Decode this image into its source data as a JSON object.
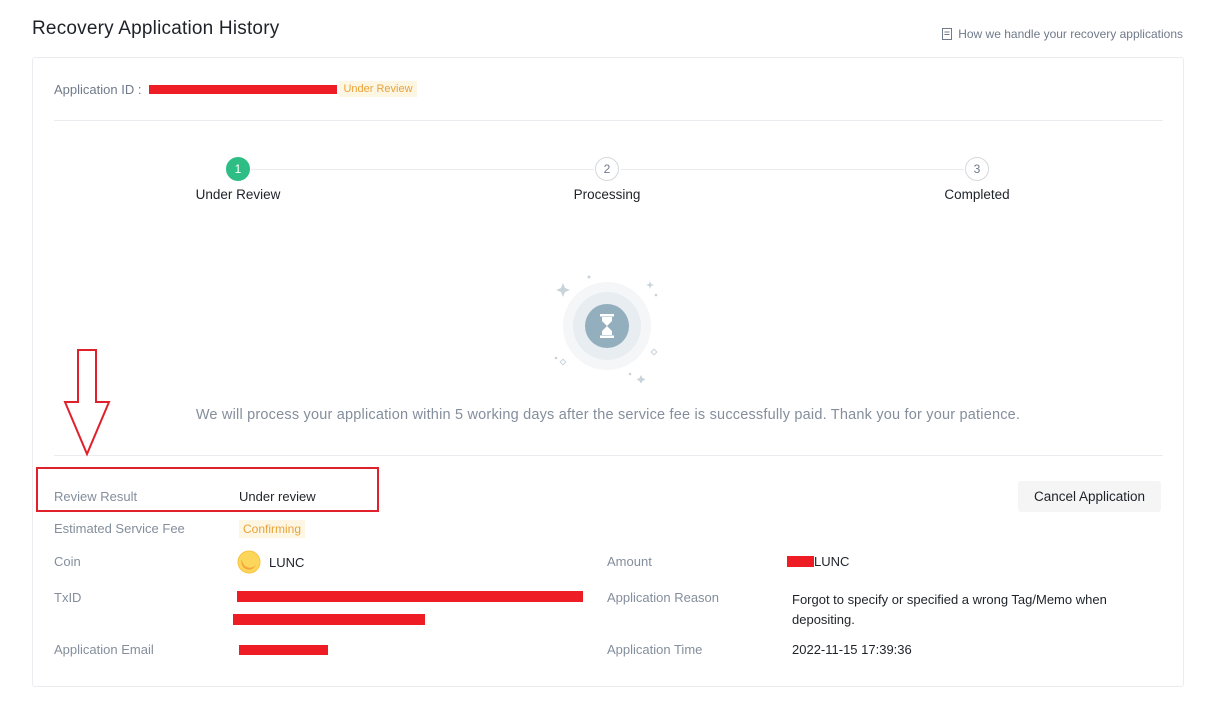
{
  "header": {
    "title": "Recovery Application History",
    "help_link": "How we handle your recovery applications"
  },
  "application": {
    "id_label": "Application ID :",
    "status_badge": "Under Review"
  },
  "steps": [
    {
      "number": "1",
      "label": "Under Review"
    },
    {
      "number": "2",
      "label": "Processing"
    },
    {
      "number": "3",
      "label": "Completed"
    }
  ],
  "notice": "We will process your application within 5 working days after the service fee is successfully paid. Thank you for your patience.",
  "details": {
    "review_result_label": "Review Result",
    "review_result_value": "Under review",
    "fee_label": "Estimated Service Fee",
    "fee_value": "Confirming",
    "coin_label": "Coin",
    "coin_value": "LUNC",
    "amount_label": "Amount",
    "amount_unit": "LUNC",
    "txid_label": "TxID",
    "reason_label": "Application Reason",
    "reason_value": "Forgot to specify or specified a wrong Tag/Memo when depositing.",
    "email_label": "Application Email",
    "time_label": "Application Time",
    "time_value": "2022-11-15 17:39:36"
  },
  "actions": {
    "cancel_label": "Cancel Application"
  },
  "colors": {
    "accent_green": "#2ebd85",
    "warning": "#e8a33a",
    "annotation_red": "#e0202a"
  }
}
